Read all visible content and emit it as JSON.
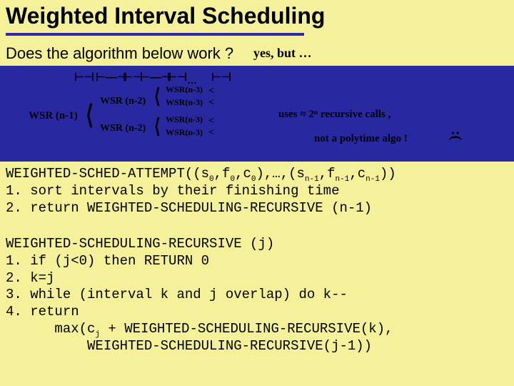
{
  "title": "Weighted Interval Scheduling",
  "question": "Does the algorithm below work ?",
  "handwriting": {
    "yes_but": "yes, but …",
    "wsr_n1": "WSR (n-1)",
    "wsr_n2a": "WSR (n-2)",
    "wsr_n2b": "WSR (n-2)",
    "wsr_n3a": "WSR(n-3)",
    "wsr_n3b": "WSR(n-3)",
    "wsr_n3c": "WSR(n-3)",
    "wsr_n3d": "WSR(n-3)",
    "dots_intervals": "…",
    "uses": "uses ≈ 2ⁿ recursive calls ,",
    "not_poly": "not a polytime algo !",
    "sadface": ":(",
    "lt1": "<",
    "lt2": "<",
    "lt3": "<",
    "lt4": "<"
  },
  "code_block_1": {
    "sig_a": "WEIGHTED-SCHED-ATTEMPT((s",
    "sig_b": ",f",
    "sig_c": ",c",
    "sig_d": "),…,(s",
    "sig_e": ",f",
    "sig_f": ",c",
    "sig_g": "))",
    "sub0a": "0",
    "sub0b": "0",
    "sub0c": "0",
    "subn1a": "n-1",
    "subn1b": "n-1",
    "subn1c": "n-1",
    "line1": "1. sort intervals by their finishing time",
    "line2": "2. return WEIGHTED-SCHEDULING-RECURSIVE (n-1)"
  },
  "code_block_2": {
    "sig": "WEIGHTED-SCHEDULING-RECURSIVE (j)",
    "line1": "1. if (j<0) then RETURN 0",
    "line2": "2. k=j",
    "line3": "3. while (interval k and j overlap) do k--",
    "line4": "4. return",
    "ret_a": "      max(c",
    "ret_sub": "j",
    "ret_b": " + WEIGHTED-SCHEDULING-RECURSIVE(k),",
    "ret_c": "          WEIGHTED-SCHEDULING-RECURSIVE(j-1))"
  }
}
